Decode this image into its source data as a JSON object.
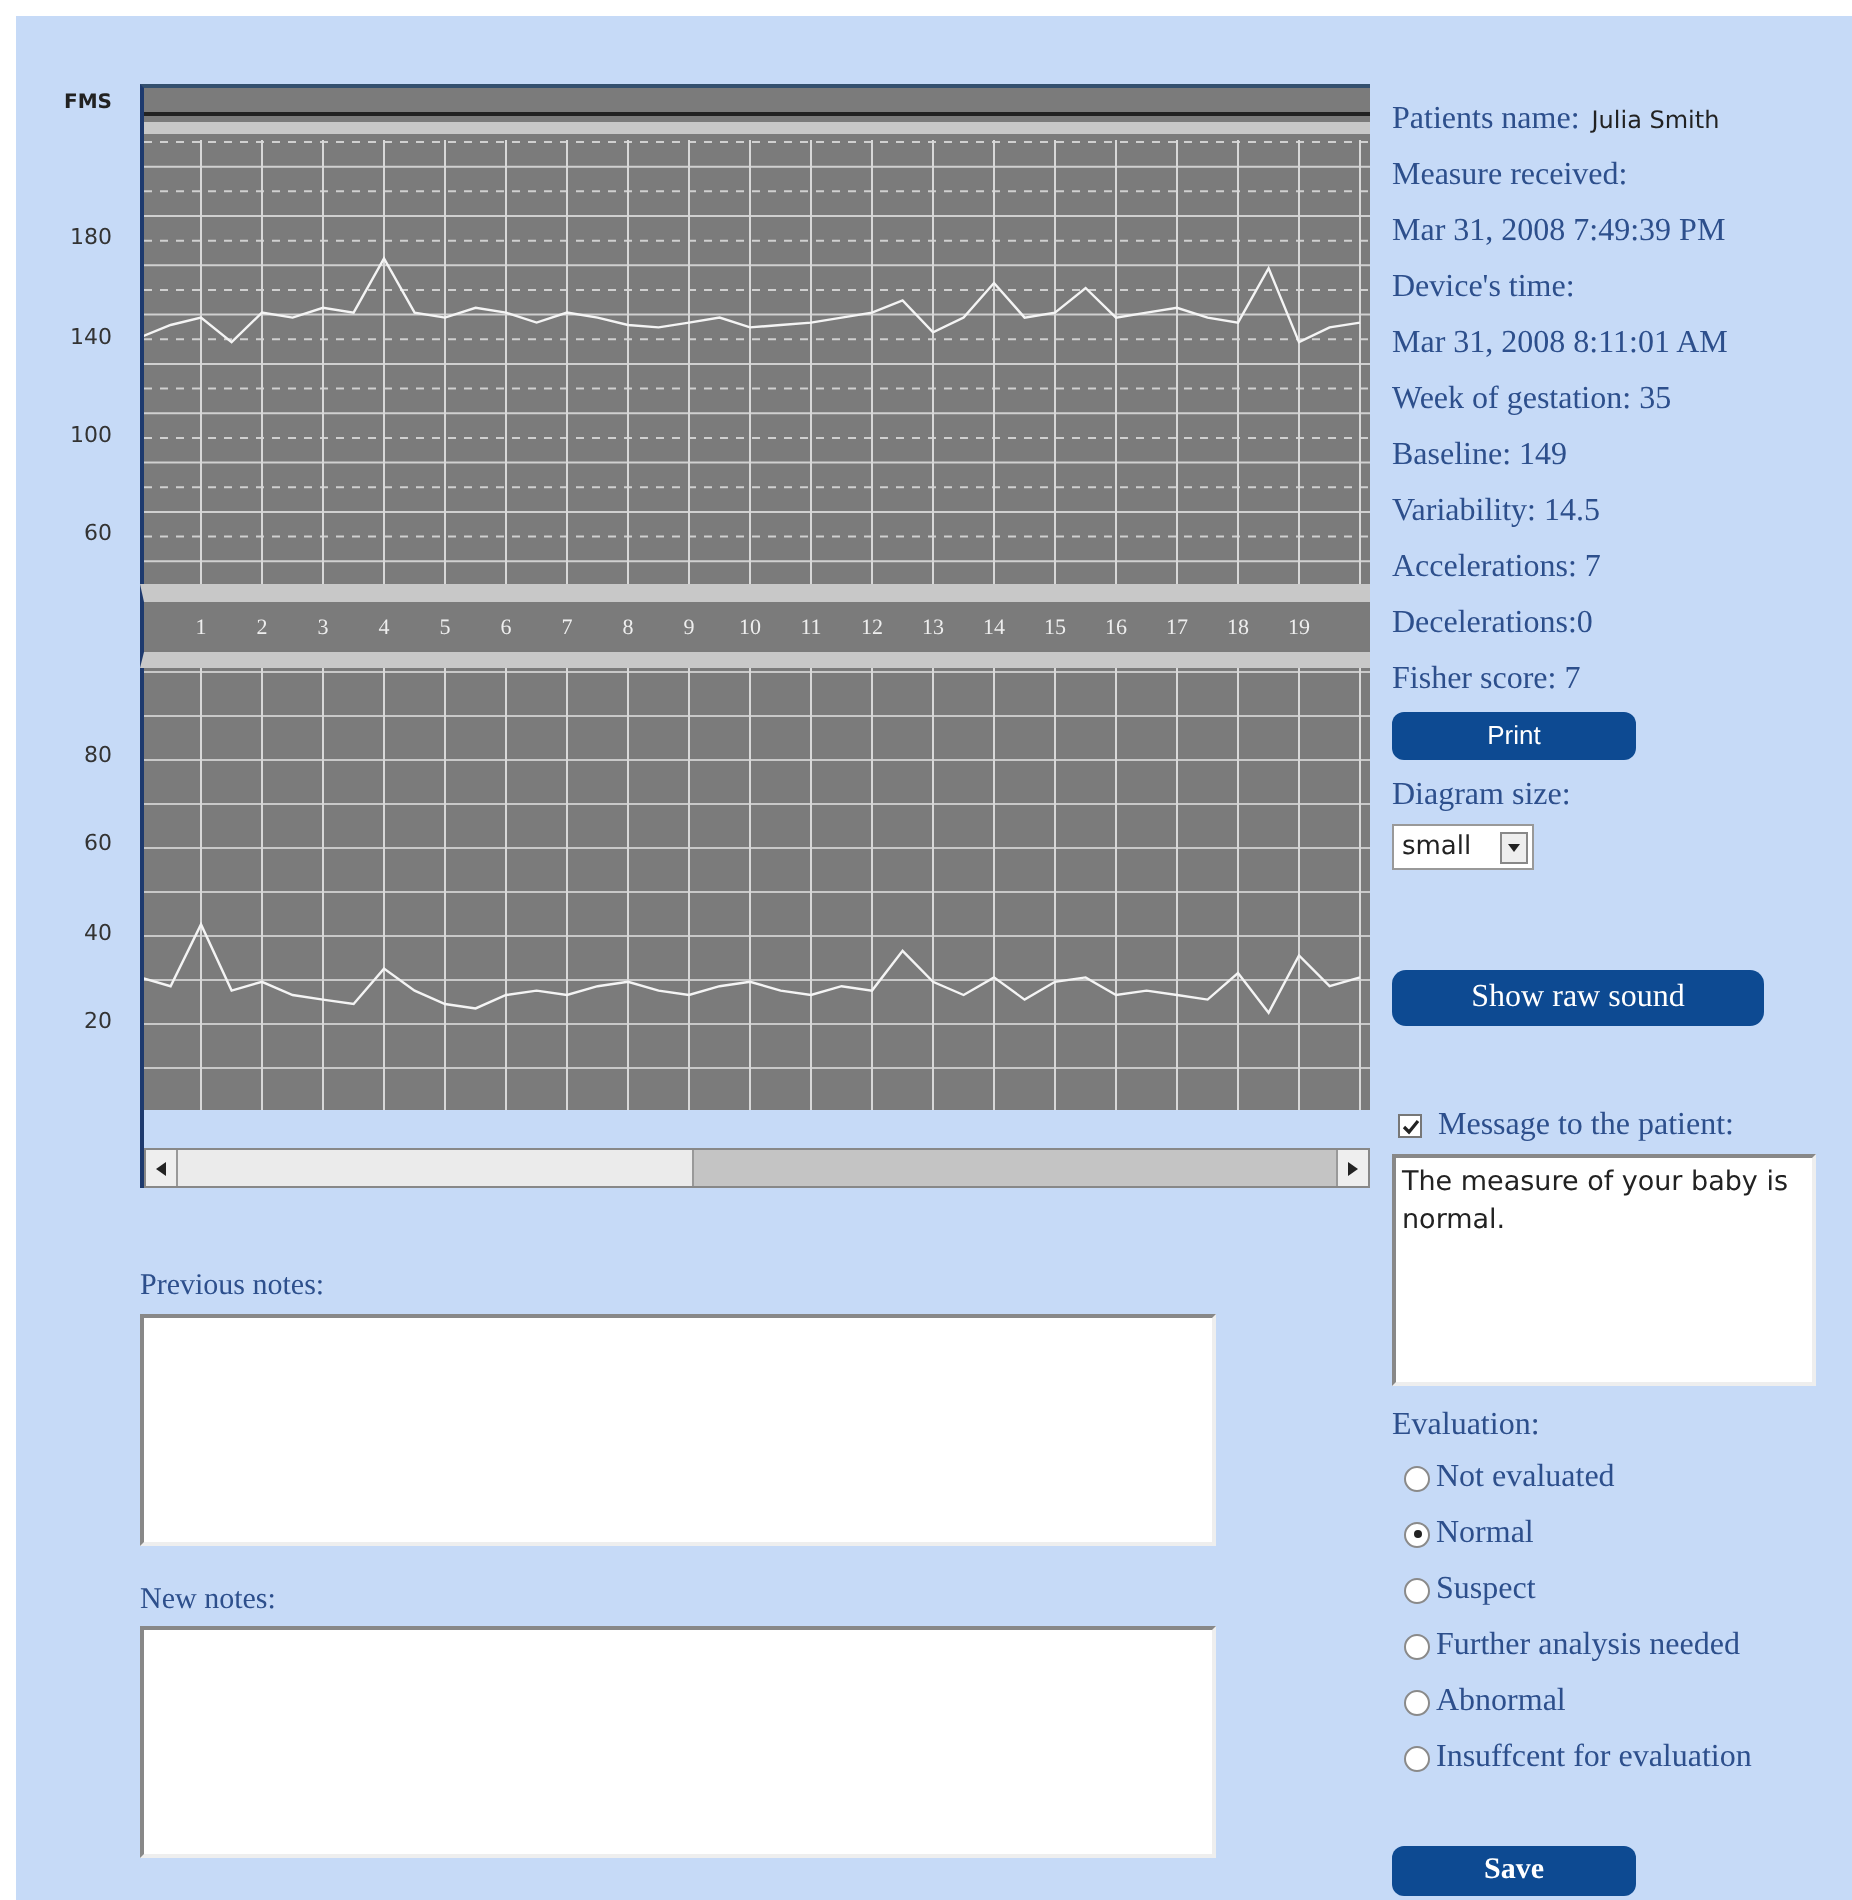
{
  "charts": [
    {
      "chart_data": {
        "type": "line",
        "ylabel": "FMS",
        "x": [
          0,
          0.5,
          1,
          1.5,
          2,
          2.5,
          3,
          3.5,
          4,
          4.5,
          5,
          5.5,
          6,
          6.5,
          7,
          7.5,
          8,
          8.5,
          9,
          9.5,
          10,
          10.5,
          11,
          11.5,
          12,
          12.5,
          13,
          13.5,
          14,
          14.5,
          15,
          15.5,
          16,
          16.5,
          17,
          17.5,
          18,
          18.5,
          19,
          19.5,
          20
        ],
        "series": [
          {
            "color": "#f4f4f4",
            "values": [
              140,
              145,
              148,
              138,
              150,
              148,
              152,
              150,
              172,
              150,
              148,
              152,
              150,
              146,
              150,
              148,
              145,
              144,
              146,
              148,
              144,
              145,
              146,
              148,
              150,
              155,
              142,
              148,
              162,
              148,
              150,
              160,
              148,
              150,
              152,
              148,
              146,
              168,
              138,
              144,
              146
            ]
          }
        ],
        "xlim": [
          0,
          20
        ],
        "ylim": [
          40,
          220
        ],
        "xticks": [
          1,
          2,
          3,
          4,
          5,
          6,
          7,
          8,
          9,
          10,
          11,
          12,
          13,
          14,
          15,
          16,
          17,
          18,
          19
        ],
        "yticks": [
          60,
          100,
          140,
          180
        ],
        "grid": true
      }
    },
    {
      "chart_data": {
        "type": "line",
        "x": [
          0,
          0.5,
          1,
          1.5,
          2,
          2.5,
          3,
          3.5,
          4,
          4.5,
          5,
          5.5,
          6,
          6.5,
          7,
          7.5,
          8,
          8.5,
          9,
          9.5,
          10,
          10.5,
          11,
          11.5,
          12,
          12.5,
          13,
          13.5,
          14,
          14.5,
          15,
          15.5,
          16,
          16.5,
          17,
          17.5,
          18,
          18.5,
          19,
          19.5,
          20
        ],
        "series": [
          {
            "color": "#f4f4f4",
            "values": [
              30,
              28,
              42,
              27,
              29,
              26,
              25,
              24,
              32,
              27,
              24,
              23,
              26,
              27,
              26,
              28,
              29,
              27,
              26,
              28,
              29,
              27,
              26,
              28,
              27,
              36,
              29,
              26,
              30,
              25,
              29,
              30,
              26,
              27,
              26,
              25,
              31,
              22,
              35,
              28,
              30
            ]
          }
        ],
        "xlim": [
          0,
          20
        ],
        "ylim": [
          0,
          100
        ],
        "yticks": [
          20,
          40,
          60,
          80
        ],
        "grid": true
      }
    }
  ],
  "notes": [
    {
      "label": "Previous notes:"
    },
    {
      "label": "New notes:"
    }
  ],
  "patient": {
    "label": "Patients name:",
    "value": "Julia Smith"
  },
  "info_lines": [
    "Measure received:",
    "Mar 31, 2008 7:49:39 PM",
    "Device's time:",
    "Mar 31, 2008 8:11:01 AM",
    "Week of gestation: 35",
    "Baseline: 149",
    "Variability: 14.5",
    "Accelerations: 7",
    "Decelerations:0",
    "Fisher score: 7"
  ],
  "print_button": "Print",
  "diagram_size": {
    "label": "Diagram size:",
    "value": "small"
  },
  "raw_sound_button": "Show raw sound",
  "message": {
    "label": "Message to the patient:",
    "checked": true,
    "value": "The measure of your baby is normal."
  },
  "evaluation": {
    "label": "Evaluation:",
    "options": [
      {
        "label": "Not evaluated",
        "selected": false
      },
      {
        "label": "Normal",
        "selected": true
      },
      {
        "label": "Suspect",
        "selected": false
      },
      {
        "label": "Further analysis needed",
        "selected": false
      },
      {
        "label": "Abnormal",
        "selected": false
      },
      {
        "label": "Insuffcent for evaluation",
        "selected": false
      }
    ]
  },
  "save_button": "Save"
}
